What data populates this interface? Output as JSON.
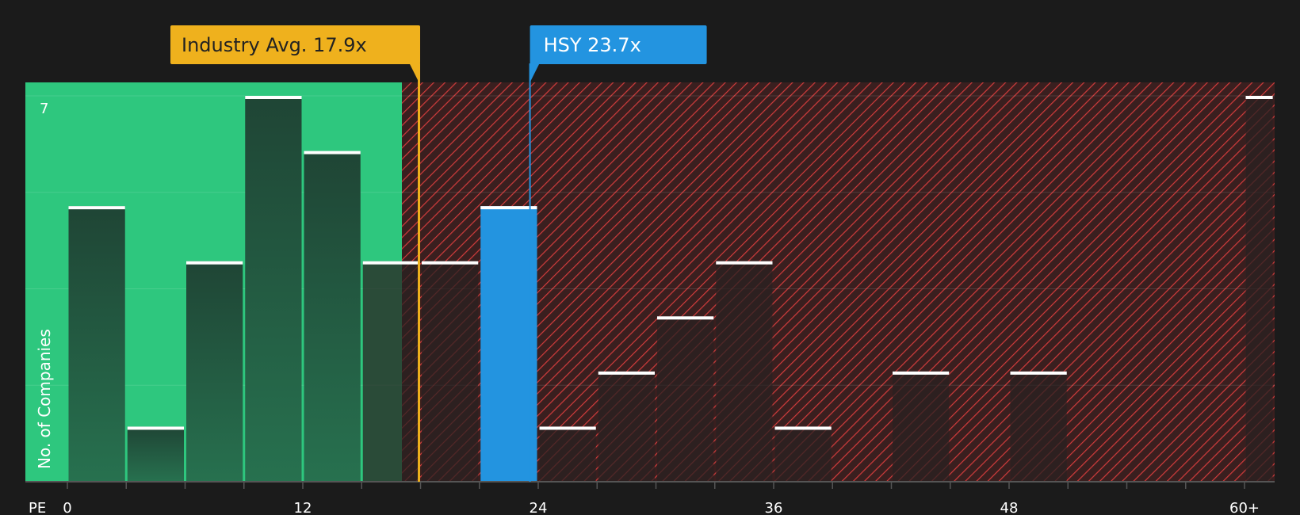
{
  "chart_data": {
    "type": "bar",
    "x_axis_label": "PE",
    "y_axis_label": "No. of Companies",
    "y_max_label": "7",
    "ylim": [
      0,
      7
    ],
    "x_tick_labels": [
      {
        "value": 0,
        "label": "0"
      },
      {
        "value": 12,
        "label": "12"
      },
      {
        "value": 24,
        "label": "24"
      },
      {
        "value": 36,
        "label": "36"
      },
      {
        "value": 48,
        "label": "48"
      },
      {
        "value": 60,
        "label": "60+"
      }
    ],
    "bins": [
      {
        "start": 0,
        "end": 3,
        "count": 5
      },
      {
        "start": 3,
        "end": 6,
        "count": 1
      },
      {
        "start": 6,
        "end": 9,
        "count": 4
      },
      {
        "start": 9,
        "end": 12,
        "count": 7
      },
      {
        "start": 12,
        "end": 15,
        "count": 6
      },
      {
        "start": 15,
        "end": 18,
        "count": 4
      },
      {
        "start": 18,
        "end": 21,
        "count": 4
      },
      {
        "start": 21,
        "end": 24,
        "count": 5,
        "highlight": true
      },
      {
        "start": 24,
        "end": 27,
        "count": 1
      },
      {
        "start": 27,
        "end": 30,
        "count": 2
      },
      {
        "start": 30,
        "end": 33,
        "count": 3
      },
      {
        "start": 33,
        "end": 36,
        "count": 4
      },
      {
        "start": 36,
        "end": 39,
        "count": 1
      },
      {
        "start": 39,
        "end": 42,
        "count": 0
      },
      {
        "start": 42,
        "end": 45,
        "count": 2
      },
      {
        "start": 45,
        "end": 48,
        "count": 0
      },
      {
        "start": 48,
        "end": 51,
        "count": 2
      },
      {
        "start": 51,
        "end": 54,
        "count": 0
      },
      {
        "start": 54,
        "end": 57,
        "count": 0
      },
      {
        "start": 57,
        "end": 60,
        "count": 0
      },
      {
        "start": 60,
        "end": 61.5,
        "count": 7
      }
    ],
    "industry_avg": {
      "value": 17.9,
      "label": "Industry Avg. 17.9x"
    },
    "company": {
      "value": 23.7,
      "label": "HSY 23.7x"
    },
    "colors": {
      "background": "#1b1b1b",
      "undervalued_zone": "#2ec77e",
      "overvalued_zone": "#3a1f1f",
      "hatch_line": "#d23c3c",
      "industry_marker": "#efb11d",
      "company_marker": "#2394e0",
      "bar_top": "#ffffff"
    }
  }
}
